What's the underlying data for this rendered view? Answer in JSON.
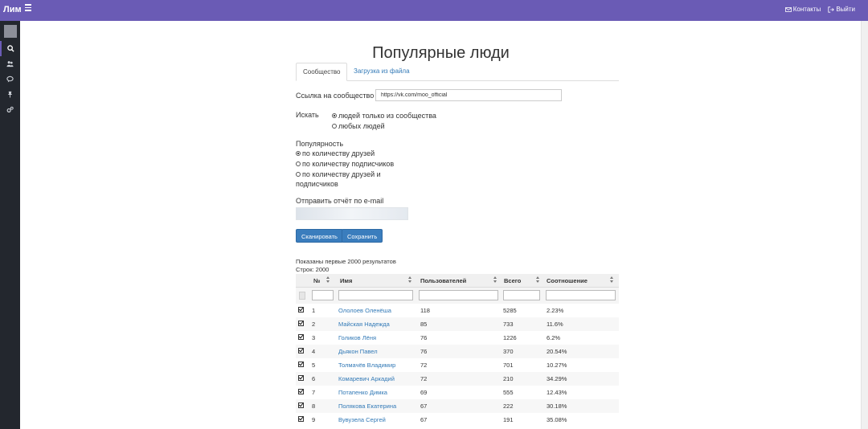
{
  "app": {
    "brand": "Лим"
  },
  "nav": {
    "contacts": "Контакты",
    "logout": "Выйти"
  },
  "page": {
    "title": "Популярные люди"
  },
  "tabs": [
    {
      "label": "Сообщество",
      "active": true
    },
    {
      "label": "Загрузка из файла",
      "active": false
    }
  ],
  "form": {
    "community_label": "Ссылка на сообщество",
    "community_value": "https://vk.com/moo_official",
    "search_label": "Искать",
    "search_options": [
      {
        "label": "людей только из сообщества",
        "selected": true
      },
      {
        "label": "любых людей",
        "selected": false
      }
    ],
    "popularity_label": "Популярность",
    "popularity_options": [
      {
        "label": "по количеству друзей",
        "selected": true
      },
      {
        "label": "по количеству подписчиков",
        "selected": false
      },
      {
        "label_line1": "по количеству друзей и",
        "label_line2": "подписчиков",
        "selected": false
      }
    ],
    "email_label": "Отправить отчёт по e-mail",
    "scan_button": "Сканировать",
    "save_button": "Сохранить"
  },
  "results": {
    "shown_text": "Показаны первые 2000 результатов",
    "rows_text": "Строк: 2000"
  },
  "table": {
    "headers": {
      "num": "№",
      "name": "Имя",
      "users": "Пользователей",
      "total": "Всего",
      "ratio": "Соотношение"
    },
    "rows": [
      {
        "num": "1",
        "name": "Ололоев Оленёша",
        "users": "118",
        "total": "5285",
        "ratio": "2.23%"
      },
      {
        "num": "2",
        "name": "Майская Надежда",
        "users": "85",
        "total": "733",
        "ratio": "11.6%"
      },
      {
        "num": "3",
        "name": "Голиков Лёня",
        "users": "76",
        "total": "1226",
        "ratio": "6.2%"
      },
      {
        "num": "4",
        "name": "Дьякон Павел",
        "users": "76",
        "total": "370",
        "ratio": "20.54%"
      },
      {
        "num": "5",
        "name": "Толмачёв Владимир",
        "users": "72",
        "total": "701",
        "ratio": "10.27%"
      },
      {
        "num": "6",
        "name": "Комаревич Аркадий",
        "users": "72",
        "total": "210",
        "ratio": "34.29%"
      },
      {
        "num": "7",
        "name": "Потапенко Димка",
        "users": "69",
        "total": "555",
        "ratio": "12.43%"
      },
      {
        "num": "8",
        "name": "Полякова Екатерина",
        "users": "67",
        "total": "222",
        "ratio": "30.18%"
      },
      {
        "num": "9",
        "name": "Вувузела Сергей",
        "users": "67",
        "total": "191",
        "ratio": "35.08%"
      }
    ]
  },
  "colors": {
    "topbar": "#6a5bb5",
    "sidebar": "#23272e",
    "link": "#337ab7",
    "button": "#3a7dbd"
  },
  "icons": {
    "sidebar": [
      "search-icon",
      "users-icon",
      "chat-icon",
      "pin-icon",
      "settings-icon"
    ],
    "nav": [
      "envelope-icon",
      "logout-icon"
    ]
  }
}
